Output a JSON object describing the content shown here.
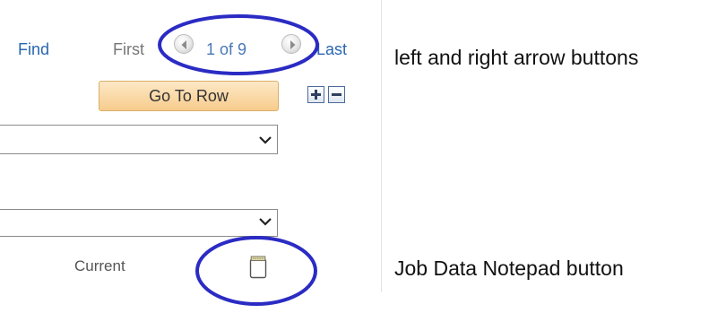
{
  "navigation": {
    "find_label": "Find",
    "first_label": "First",
    "counter_text": "1 of 9",
    "last_label": "Last",
    "previous_icon": "left-arrow-icon",
    "next_icon": "right-arrow-icon"
  },
  "row_controls": {
    "goto_row_label": "Go To Row",
    "add_icon": "plus-icon",
    "remove_icon": "minus-icon"
  },
  "fields": {
    "status_label": "Current",
    "notepad_icon": "notepad-icon"
  },
  "annotations": {
    "arrows_note": "left and right arrow buttons",
    "notepad_note": "Job Data Notepad button"
  },
  "colors": {
    "link": "#2a66b0",
    "goto_button": "#f7cc8c",
    "highlight_ellipse": "#2b2bc4"
  }
}
